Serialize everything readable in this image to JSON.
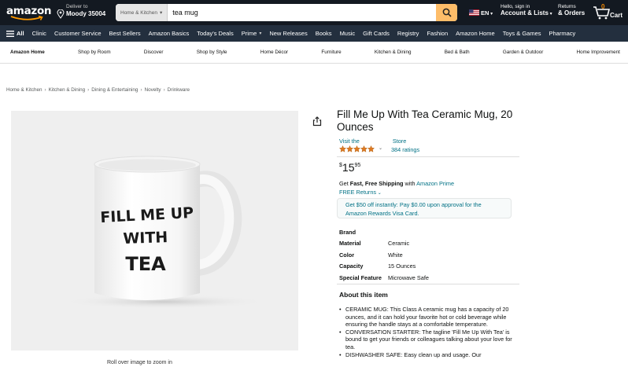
{
  "header": {
    "logo_text": "amazon",
    "deliver_line1": "Deliver to",
    "deliver_line2": "Moody 35004",
    "search_category": "Home & Kitchen",
    "search_value": "tea mug",
    "language": "EN",
    "account_line1": "Hello, sign in",
    "account_line2": "Account & Lists",
    "returns_line1": "Returns",
    "returns_line2": "& Orders",
    "cart_count": "0",
    "cart_label": "Cart"
  },
  "nav2": {
    "all_label": "All",
    "items": [
      "Clinic",
      "Customer Service",
      "Best Sellers",
      "Amazon Basics",
      "Today's Deals",
      "Prime",
      "New Releases",
      "Books",
      "Music",
      "Gift Cards",
      "Registry",
      "Fashion",
      "Amazon Home",
      "Toys & Games",
      "Pharmacy"
    ]
  },
  "nav3": {
    "items": [
      "Amazon Home",
      "Shop by Room",
      "Discover",
      "Shop by Style",
      "Home Décor",
      "Furniture",
      "Kitchen & Dining",
      "Bed & Bath",
      "Garden & Outdoor",
      "Home Improvement"
    ]
  },
  "breadcrumb": [
    "Home & Kitchen",
    "Kitchen & Dining",
    "Dining & Entertaining",
    "Novelty",
    "Drinkware"
  ],
  "product": {
    "mug_text_line1": "FILL ME UP",
    "mug_text_line2": "WITH",
    "mug_text_line3": "TEA",
    "zoom_hint": "Roll over image to zoom in",
    "title": "Fill Me Up With Tea Ceramic Mug, 20 Ounces",
    "visit_store_1": "Visit the",
    "visit_store_2": "Store",
    "rating_stars": 5,
    "ratings_count": "384 ratings",
    "price_symbol": "$",
    "price_whole": "15",
    "price_fraction": "95",
    "shipping_prefix": "Get ",
    "shipping_bold": "Fast, Free Shipping",
    "shipping_mid": " with ",
    "shipping_link": "Amazon Prime",
    "returns_link": "FREE Returns",
    "promo_line1": "Get $50 off instantly: Pay $0.00 upon approval for the",
    "promo_line2": "Amazon Rewards Visa Card.",
    "specs": [
      {
        "k": "Brand",
        "v": ""
      },
      {
        "k": "Material",
        "v": "Ceramic"
      },
      {
        "k": "Color",
        "v": "White"
      },
      {
        "k": "Capacity",
        "v": "15 Ounces"
      },
      {
        "k": "Special Feature",
        "v": "Microwave Safe"
      }
    ],
    "about_title": "About this item",
    "bullets": [
      "CERAMIC MUG: This Class A ceramic mug has a capacity of 20 ounces, and it can hold your favorite hot or cold beverage while ensuring the handle stays at a comfortable temperature.",
      "CONVERSATION STARTER: The tagline 'Fill Me Up With Tea' is bound to get your friends or colleagues talking about your love for tea.",
      "DISHWASHER SAFE: Easy clean up and usage. Our"
    ]
  },
  "colors": {
    "nav_dark": "#131921",
    "nav_secondary": "#232f3e",
    "search_button": "#febd69",
    "star": "#de7921",
    "link": "#007185"
  }
}
